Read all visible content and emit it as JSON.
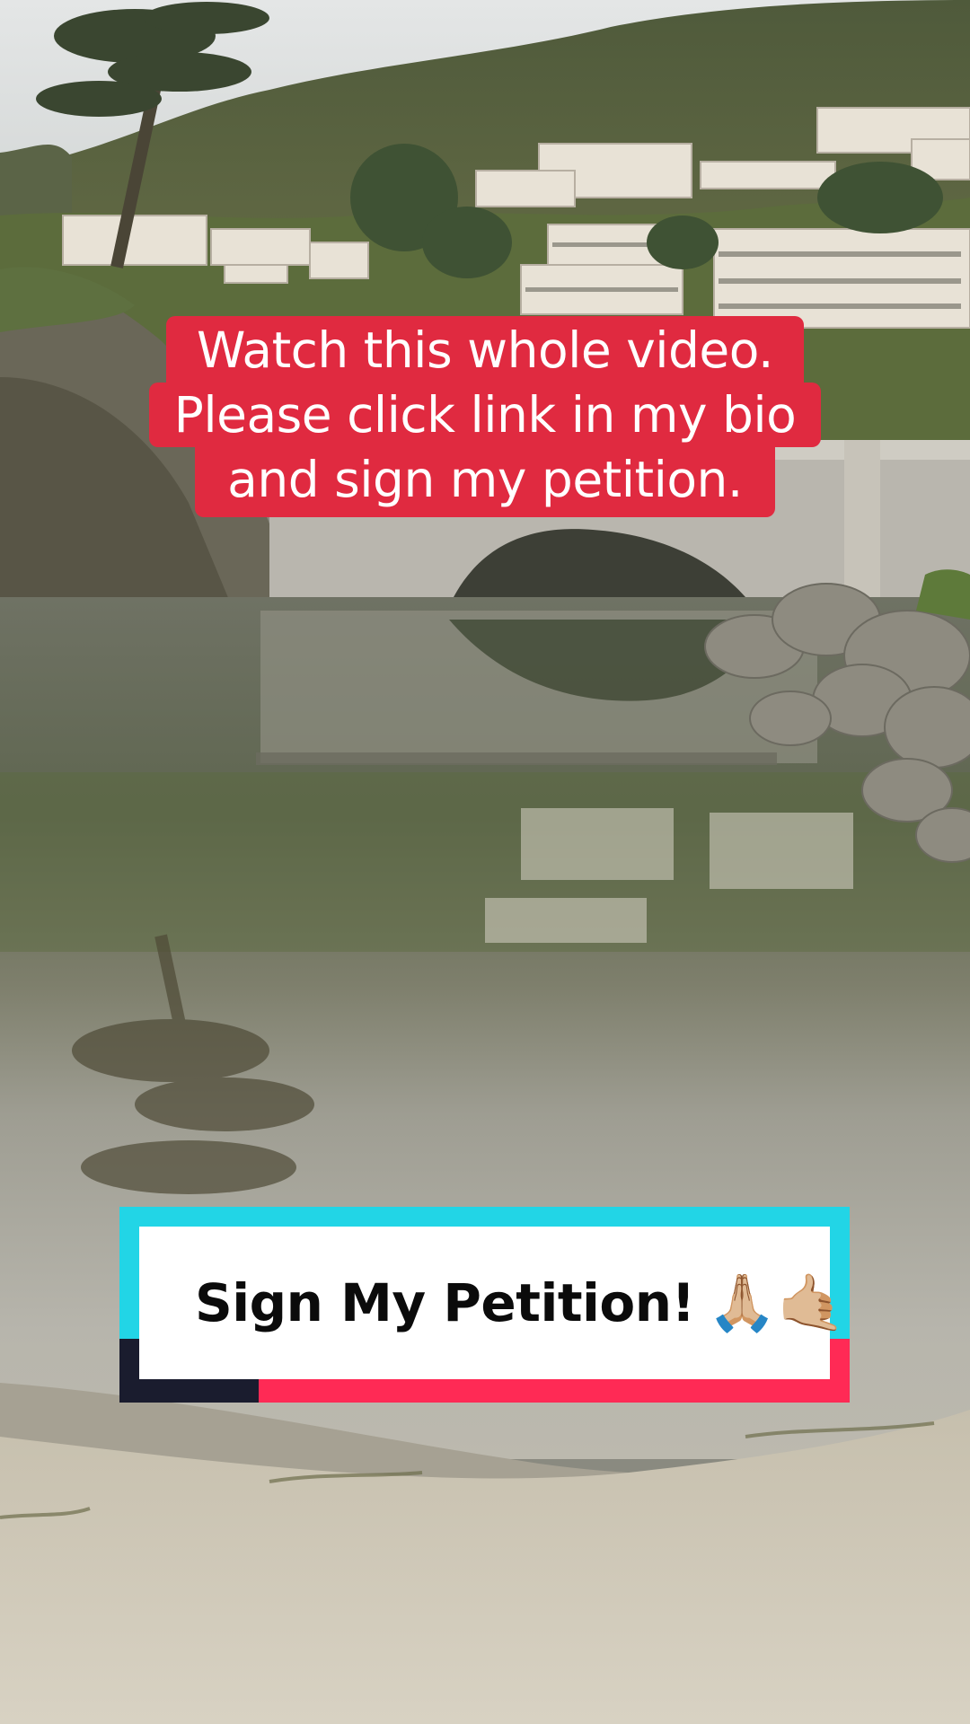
{
  "caption": {
    "line1": "Watch this whole video.",
    "line2": "Please click link in my bio",
    "line3": "and sign my petition."
  },
  "banner": {
    "text": "Sign My Petition!",
    "emoji": "🙏🏼🤙🏼"
  },
  "colors": {
    "caption_bg": "#e02a40",
    "banner_cyan": "#22d5e6",
    "banner_pink": "#ff2a55",
    "banner_navy": "#1a1c2e"
  }
}
